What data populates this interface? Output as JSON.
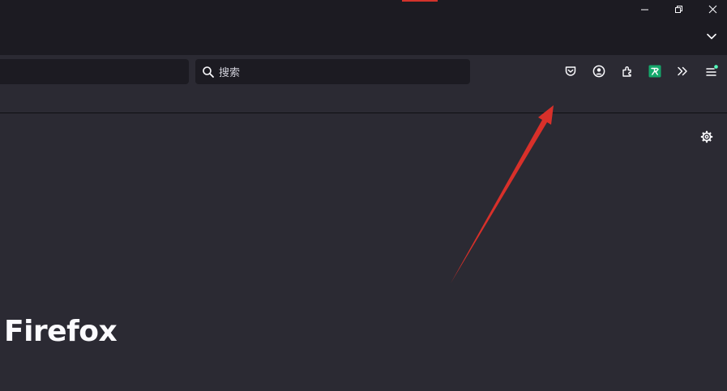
{
  "window": {
    "minimize_label": "minimize",
    "restore_label": "restore",
    "close_label": "close"
  },
  "search": {
    "placeholder": "搜索"
  },
  "toolbar": {
    "icons": [
      "pocket-icon",
      "account-icon",
      "extensions-icon",
      "translate-extension-icon",
      "overflow-icon",
      "menu-icon"
    ]
  },
  "newtab": {
    "wordmark": "Firefox"
  },
  "annotation": {
    "arrow_color": "#d8302a"
  },
  "colors": {
    "titlebar": "#1c1b22",
    "toolbar": "#2b2a33",
    "field": "#1c1b22",
    "extension_green": "#14a86b",
    "notification_dot": "#54ffbd"
  }
}
